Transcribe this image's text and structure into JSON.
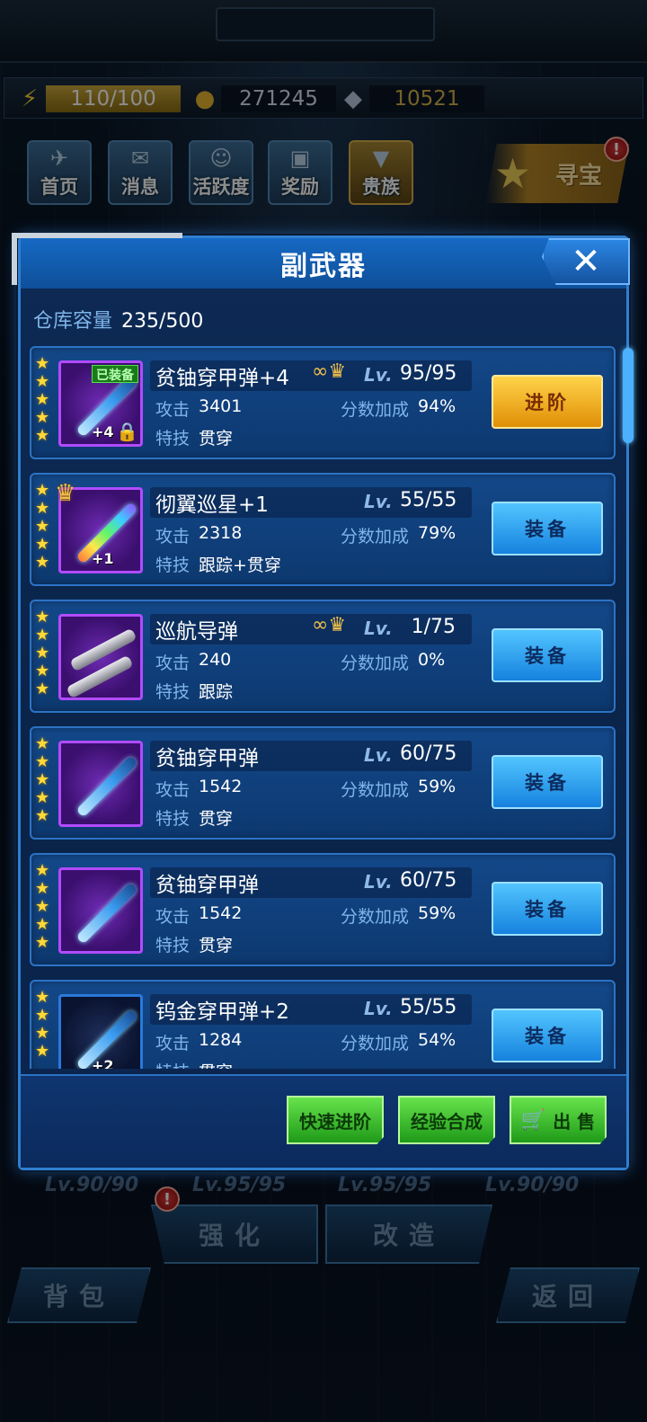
{
  "resources": {
    "energy": "110/100",
    "gold": "271245",
    "gems": "10521"
  },
  "nav": [
    {
      "label": "首页"
    },
    {
      "label": "消息"
    },
    {
      "label": "活跃度"
    },
    {
      "label": "奖励"
    },
    {
      "label": "贵族"
    }
  ],
  "treasure": {
    "label": "寻宝",
    "badge": "!"
  },
  "background": {
    "levels": [
      "Lv.90/90",
      "Lv.95/95",
      "Lv.95/95",
      "Lv.90/90"
    ],
    "enhance_label": "强化",
    "modify_label": "改造",
    "backpack_label": "背包",
    "back_label": "返回",
    "enhance_badge": "!"
  },
  "dialog": {
    "title": "副武器",
    "close_symbol": "✕",
    "capacity_label": "仓库容量",
    "capacity_value": "235/500",
    "lv_label": "Lv.",
    "attack_label": "攻击",
    "bonus_label": "分数加成",
    "skill_label": "特技",
    "items": [
      {
        "name": "贫铀穿甲弹+4",
        "level": "95/95",
        "attack": "3401",
        "bonus": "94%",
        "skill": "贯穿",
        "action": "进阶",
        "equipped_tag": "已装备",
        "plus": "+4"
      },
      {
        "name": "彻翼巡星+1",
        "level": "55/55",
        "attack": "2318",
        "bonus": "79%",
        "skill": "跟踪+贯穿",
        "action": "装备",
        "plus": "+1"
      },
      {
        "name": "巡航导弹",
        "level": "1/75",
        "attack": "240",
        "bonus": "0%",
        "skill": "跟踪",
        "action": "装备"
      },
      {
        "name": "贫铀穿甲弹",
        "level": "60/75",
        "attack": "1542",
        "bonus": "59%",
        "skill": "贯穿",
        "action": "装备"
      },
      {
        "name": "贫铀穿甲弹",
        "level": "60/75",
        "attack": "1542",
        "bonus": "59%",
        "skill": "贯穿",
        "action": "装备"
      },
      {
        "name": "钨金穿甲弹+2",
        "level": "55/55",
        "attack": "1284",
        "bonus": "54%",
        "skill": "贯穿",
        "action": "装备",
        "plus": "+2"
      }
    ],
    "footer": {
      "quick_advance": "快速进阶",
      "exp_merge": "经验合成",
      "sell": "出 售"
    }
  }
}
